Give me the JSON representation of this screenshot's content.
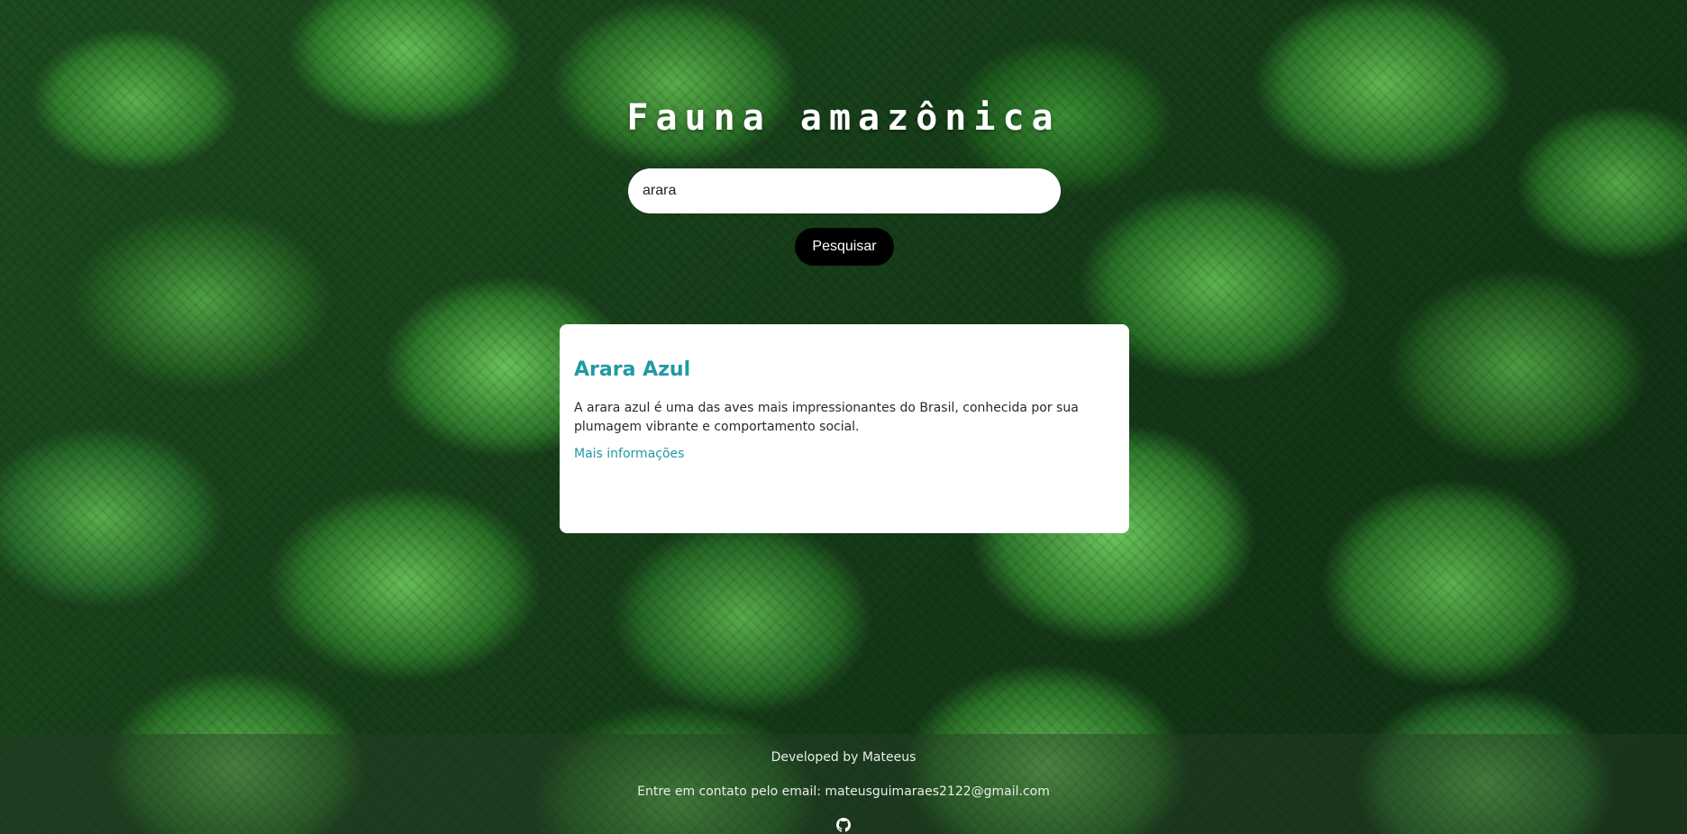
{
  "header": {
    "title": "Fauna amazônica"
  },
  "search": {
    "value": "arara",
    "placeholder": "",
    "button_label": "Pesquisar"
  },
  "result": {
    "title": "Arara Azul",
    "description": "A arara azul é uma das aves mais impressionantes do Brasil, conhecida por sua plumagem vibrante e comportamento social.",
    "link_label": "Mais informações"
  },
  "footer": {
    "developed_by": "Developed by Mateeus",
    "contact": "Entre em contato pelo email: mateusguimaraes2122@gmail.com",
    "icon": "github-icon"
  },
  "colors": {
    "accent": "#1f9aa3",
    "button_bg": "#000000",
    "card_bg": "#ffffff"
  }
}
